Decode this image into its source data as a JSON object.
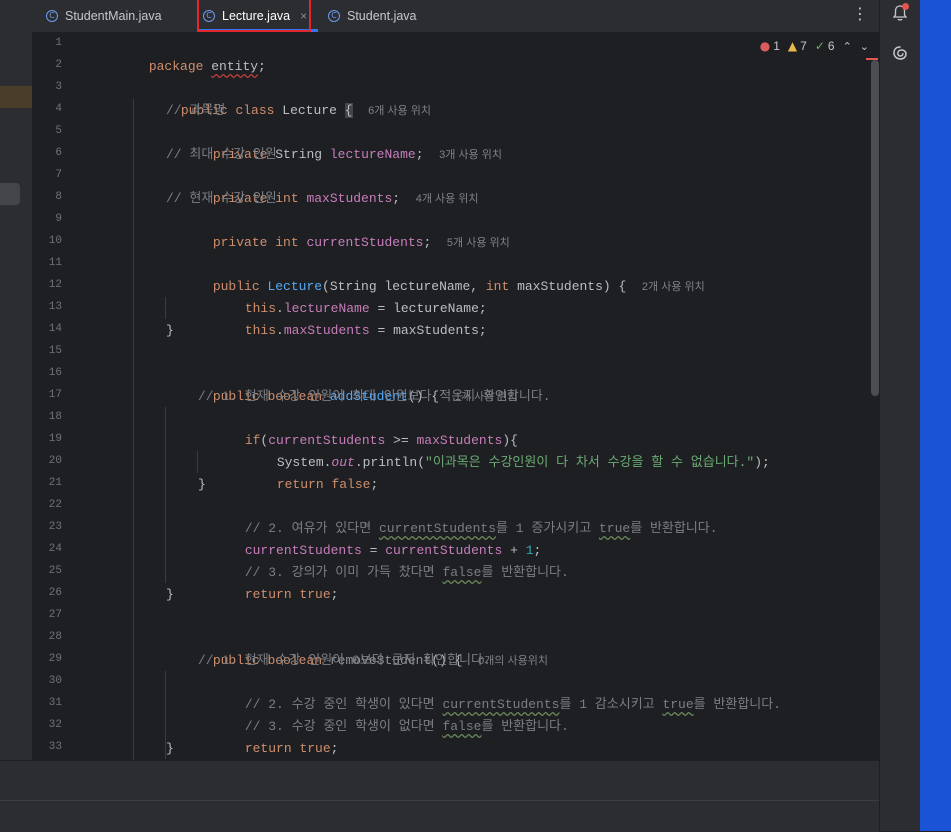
{
  "tabs": [
    {
      "label": "StudentMain.java",
      "active": false
    },
    {
      "label": "Lecture.java",
      "active": true,
      "close": "×"
    },
    {
      "label": "Student.java",
      "active": false
    }
  ],
  "file_icon_glyph": "C",
  "more_glyph": "⋮",
  "inspections": {
    "errors": "1",
    "warnings": "7",
    "weak_warnings": "6",
    "up_arrow": "⌃",
    "down_arrow": "⌄"
  },
  "line_numbers": [
    "1",
    "2",
    "3",
    "4",
    "5",
    "6",
    "7",
    "8",
    "9",
    "10",
    "11",
    "12",
    "13",
    "14",
    "15",
    "16",
    "17",
    "18",
    "19",
    "20",
    "21",
    "22",
    "23",
    "24",
    "25",
    "26",
    "27",
    "28",
    "29",
    "30",
    "31",
    "32",
    "33"
  ],
  "code": {
    "l1": {
      "kw": "package",
      "pkg": "entity",
      "semi": ";"
    },
    "l3": {
      "kw1": "public",
      "kw2": "class",
      "name": "Lecture",
      "brace": "{",
      "hint": "6개 사용 위치"
    },
    "l4": {
      "cmt": "// 과목명"
    },
    "l5": {
      "kw": "private",
      "type": "String",
      "field": "lectureName",
      "semi": ";",
      "hint": "3개 사용 위치"
    },
    "l6": {
      "cmt": "// 최대 수강 인원"
    },
    "l7": {
      "kw1": "private",
      "kw2": "int",
      "field": "maxStudents",
      "semi": ";",
      "hint": "4개 사용 위치"
    },
    "l8": {
      "cmt": "// 현재 수강 인원"
    },
    "l9": {
      "kw1": "private",
      "kw2": "int",
      "field": "currentStudents",
      "semi": ";",
      "hint": "5개 사용 위치"
    },
    "l11": {
      "kw": "public",
      "name": "Lecture",
      "p1": "(String lectureName, ",
      "kw2": "int",
      "p2": " maxStudents) {",
      "hint": "2개 사용 위치"
    },
    "l12": {
      "kw": "this",
      "dot": ".",
      "field": "lectureName",
      "rest": " = lectureName;"
    },
    "l13": {
      "kw": "this",
      "dot": ".",
      "field": "maxStudents",
      "rest": " = maxStudents;"
    },
    "l14": {
      "text": "}"
    },
    "l16": {
      "kw1": "public",
      "kw2": "boolean",
      "fn": "addStudent",
      "rest": "() {",
      "hint": "1개 사용 위치"
    },
    "l17": {
      "cmt": "// 1. 현재 수강 인원이 최대 인원보다 적은지 확인합니다."
    },
    "l18": {
      "kw": "if",
      "p1": "(",
      "f1": "currentStudents",
      "op": " >= ",
      "f2": "maxStudents",
      "p2": "){"
    },
    "l19": {
      "p1": "System.",
      "out": "out",
      "p2": ".println(",
      "str": "\"이과목은 수강인원이 다 차서 수강을 할 수 없습니다.\"",
      "p3": ");"
    },
    "l20": {
      "kw1": "return",
      "kw2": "false",
      "semi": ";"
    },
    "l21": {
      "text": "}"
    },
    "l22": {
      "c1": "// 2. 여유가 있다면 ",
      "w1": "currentStudents",
      "c2": "를 1 증가시키고 ",
      "w2": "true",
      "c3": "를 반환합니다."
    },
    "l23": {
      "f1": "currentStudents",
      "op": " = ",
      "f2": "currentStudents",
      "op2": " + ",
      "num": "1",
      "semi": ";"
    },
    "l24": {
      "c1": "// 3. 강의가 이미 가득 찼다면 ",
      "w1": "false",
      "c2": "를 반환합니다."
    },
    "l25": {
      "kw1": "return",
      "kw2": "true",
      "semi": ";"
    },
    "l26": {
      "text": "}"
    },
    "l28": {
      "kw1": "public",
      "kw2": "boolean",
      "fn": "removeStudent",
      "rest": "() {",
      "hint": "0개의 사용위치"
    },
    "l29": {
      "cmt": "// 1. 현재 수강 인원이 0보다 큰지 확인합니다."
    },
    "l30": {
      "c1": "// 2. 수강 중인 학생이 있다면 ",
      "w1": "currentStudents",
      "c2": "를 1 감소시키고 ",
      "w2": "true",
      "c3": "를 반환합니다."
    },
    "l31": {
      "c1": "// 3. 수강 중인 학생이 없다면 ",
      "w1": "false",
      "c2": "를 반환합니다."
    },
    "l32": {
      "kw1": "return",
      "kw2": "true",
      "semi": ";"
    },
    "l33": {
      "text": "}"
    }
  },
  "colors": {
    "keyword": "#cf8e6d",
    "field": "#c77dbb",
    "method": "#56a8f5",
    "string": "#6aab73",
    "number": "#2aacb8",
    "comment": "#7a7e85",
    "active_tab_highlight": "#e0282e"
  },
  "icons": {
    "bell": "notifications-bell-icon",
    "ai": "ai-assistant-swirl-icon",
    "file": "java-class-icon"
  }
}
